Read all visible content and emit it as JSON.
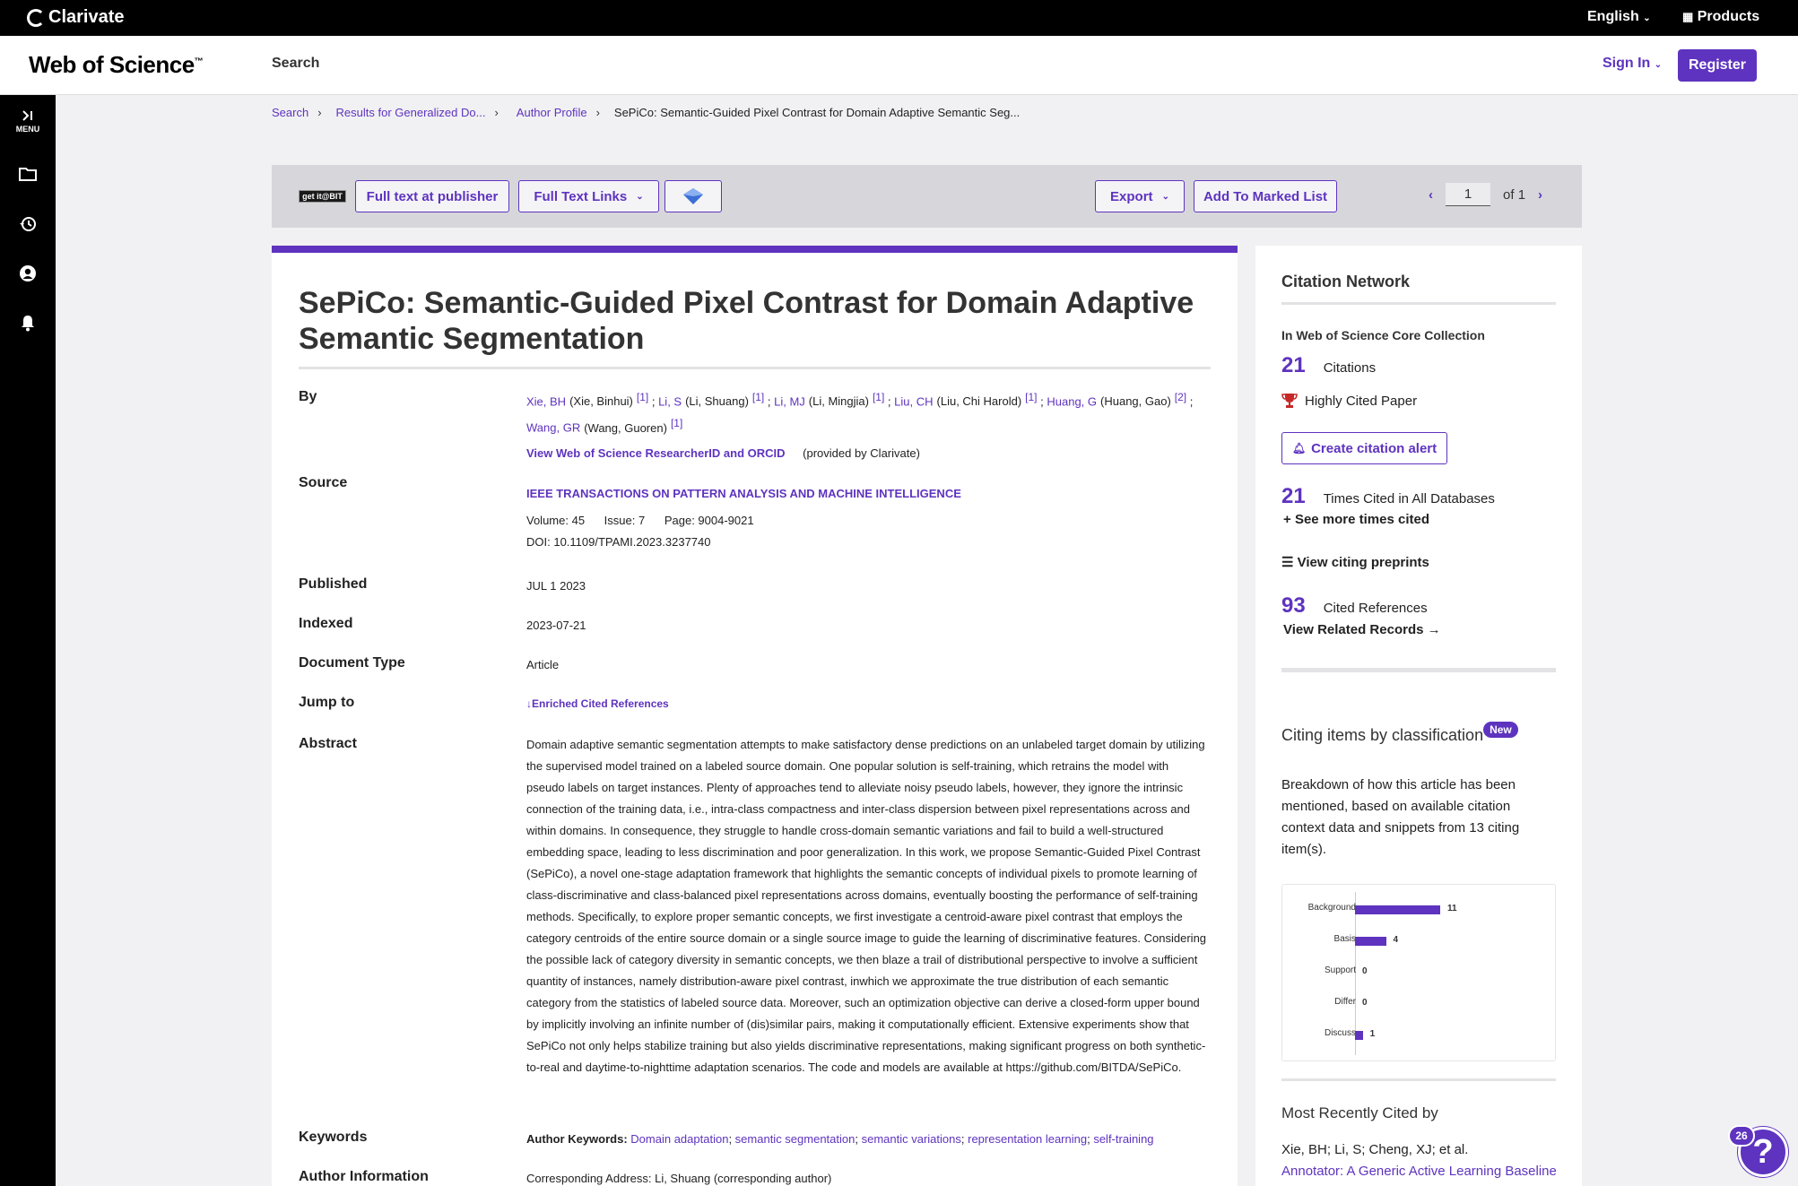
{
  "header": {
    "brand": "Clarivate",
    "language": "English",
    "products": "Products"
  },
  "nav": {
    "app_name": "Web of Science",
    "trademark": "™",
    "search": "Search",
    "sign_in": "Sign In",
    "register": "Register"
  },
  "sidenav": {
    "menu_label": "MENU"
  },
  "breadcrumb": [
    "Search",
    "Results for Generalized Do...",
    "Author Profile",
    "SePiCo: Semantic-Guided Pixel Contrast for Domain Adaptive Semantic Seg..."
  ],
  "toolbar": {
    "getit": "get it@BIT",
    "full_text_publisher": "Full text at publisher",
    "full_text_links": "Full Text Links",
    "export": "Export",
    "add_marked": "Add To Marked List",
    "page": "1",
    "of": "of",
    "total": "1"
  },
  "record": {
    "title": "SePiCo: Semantic-Guided Pixel Contrast for Domain Adaptive Semantic Segmentation",
    "labels": {
      "by": "By",
      "source": "Source",
      "published": "Published",
      "indexed": "Indexed",
      "doctype": "Document Type",
      "jump": "Jump to",
      "abstract": "Abstract",
      "keywords": "Keywords",
      "author_info": "Author Information"
    },
    "authors": [
      {
        "abbr": "Xie, BH",
        "full": "(Xie, Binhui)",
        "aff": "[1]"
      },
      {
        "abbr": "Li, S",
        "full": "(Li, Shuang)",
        "aff": "[1]"
      },
      {
        "abbr": "Li, MJ",
        "full": "(Li, Mingjia)",
        "aff": "[1]"
      },
      {
        "abbr": "Liu, CH",
        "full": "(Liu, Chi Harold)",
        "aff": "[1]"
      },
      {
        "abbr": "Huang, G",
        "full": "(Huang, Gao)",
        "aff": "[2]"
      },
      {
        "abbr": "Wang, GR",
        "full": "(Wang, Guoren)",
        "aff": "[1]"
      }
    ],
    "researcher_link": "View Web of Science ResearcherID and ORCID",
    "provided_by": "(provided by Clarivate)",
    "journal": "IEEE TRANSACTIONS ON PATTERN ANALYSIS AND MACHINE INTELLIGENCE",
    "volume": "Volume: 45",
    "issue": "Issue: 7",
    "pages": "Page: 9004-9021",
    "doi": "DOI: 10.1109/TPAMI.2023.3237740",
    "published": "JUL 1 2023",
    "indexed": "2023-07-21",
    "doctype": "Article",
    "jump_link": "Enriched Cited References",
    "abstract": "Domain adaptive semantic segmentation attempts to make satisfactory dense predictions on an unlabeled target domain by utilizing the supervised model trained on a labeled source domain. One popular solution is self-training, which retrains the model with pseudo labels on target instances. Plenty of approaches tend to alleviate noisy pseudo labels, however, they ignore the intrinsic connection of the training data, i.e., intra-class compactness and inter-class dispersion between pixel representations across and within domains. In consequence, they struggle to handle cross-domain semantic variations and fail to build a well-structured embedding space, leading to less discrimination and poor generalization. In this work, we propose Semantic-Guided Pixel Contrast (SePiCo), a novel one-stage adaptation framework that highlights the semantic concepts of individual pixels to promote learning of class-discriminative and class-balanced pixel representations across domains, eventually boosting the performance of self-training methods. Specifically, to explore proper semantic concepts, we first investigate a centroid-aware pixel contrast that employs the category centroids of the entire source domain or a single source image to guide the learning of discriminative features. Considering the possible lack of category diversity in semantic concepts, we then blaze a trail of distributional perspective to involve a sufficient quantity of instances, namely distribution-aware pixel contrast, inwhich we approximate the true distribution of each semantic category from the statistics of labeled source data. Moreover, such an optimization objective can derive a closed-form upper bound by implicitly involving an infinite number of (dis)similar pairs, making it computationally efficient. Extensive experiments show that SePiCo not only helps stabilize training but also yields discriminative representations, making significant progress on both synthetic-to-real and daytime-to-nighttime adaptation scenarios. The code and models are available at https://github.com/BITDA/SePiCo.",
    "keywords_prefix": "Author Keywords:",
    "keywords": [
      "Domain adaptation",
      "semantic segmentation",
      "semantic variations",
      "representation learning",
      "self-training"
    ],
    "corresponding": "Corresponding Address: Li, Shuang  (corresponding author)"
  },
  "sidebar": {
    "citation_network": "Citation Network",
    "core_collection": "In Web of Science Core Collection",
    "citations_num": "21",
    "citations_label": "Citations",
    "highly_cited": "Highly Cited Paper",
    "create_alert": "Create citation alert",
    "all_db_num": "21",
    "all_db_label": "Times Cited in All Databases",
    "see_more": "See more times cited",
    "citing_preprints": "View citing preprints",
    "refs_num": "93",
    "refs_label": "Cited References",
    "related": "View Related Records",
    "classification_title": "Citing items by classification",
    "new_badge": "New",
    "classification_desc": "Breakdown of how this article has been mentioned, based on available citation context data and snippets from 13 citing item(s).",
    "recent_title": "Most Recently Cited by",
    "recent_authors": "Xie, BH; Li, S; Cheng, XJ; et al.",
    "recent_paper": "Annotator: A Generic Active Learning Baseline"
  },
  "chart_data": {
    "type": "bar",
    "orientation": "horizontal",
    "categories": [
      "Background",
      "Basis",
      "Support",
      "Differ",
      "Discuss"
    ],
    "values": [
      11,
      4,
      0,
      0,
      1
    ],
    "color": "#5e33bf"
  },
  "help": {
    "badge": "26",
    "icon": "?"
  }
}
